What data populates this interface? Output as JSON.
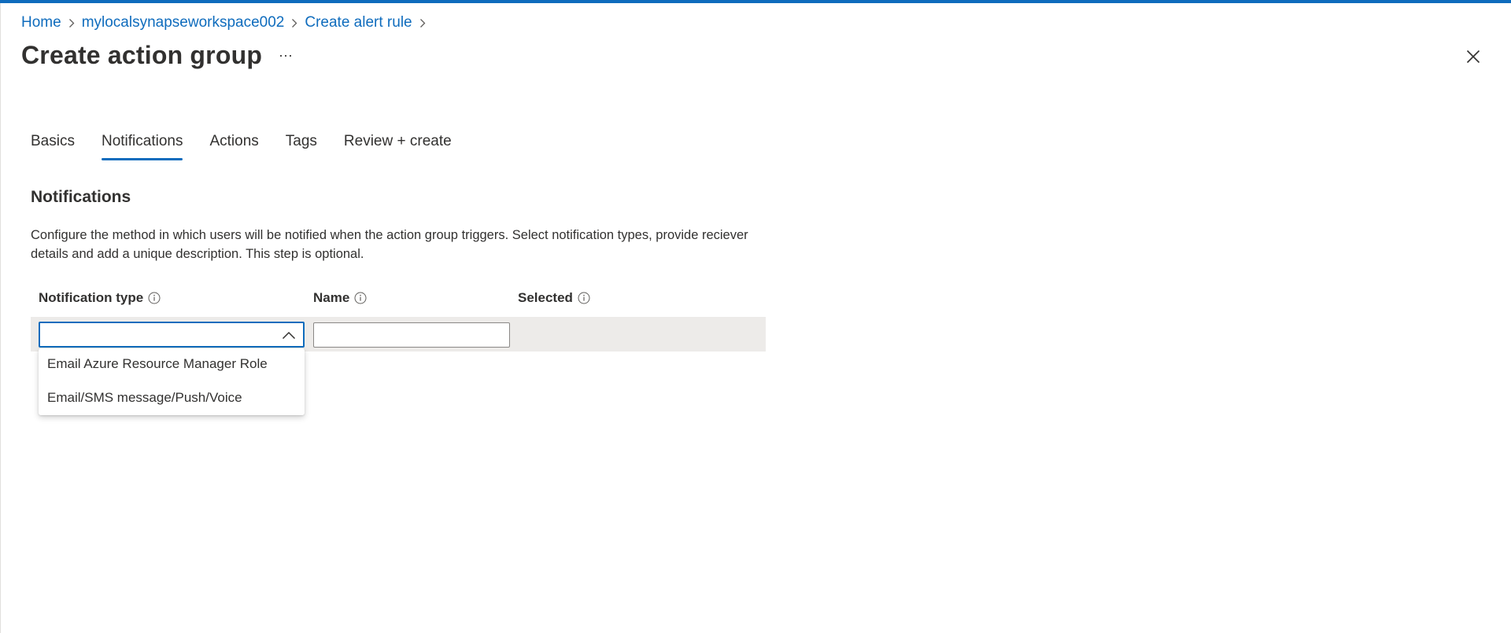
{
  "breadcrumb": {
    "items": [
      {
        "label": "Home"
      },
      {
        "label": "mylocalsynapseworkspace002"
      },
      {
        "label": "Create alert rule"
      }
    ]
  },
  "header": {
    "title": "Create action group",
    "more_label": "···"
  },
  "tabs": [
    {
      "label": "Basics",
      "active": false
    },
    {
      "label": "Notifications",
      "active": true
    },
    {
      "label": "Actions",
      "active": false
    },
    {
      "label": "Tags",
      "active": false
    },
    {
      "label": "Review + create",
      "active": false
    }
  ],
  "notifications": {
    "section_title": "Notifications",
    "description": "Configure the method in which users will be notified when the action group triggers. Select notification types, provide reciever details and add a unique description. This step is optional.",
    "columns": {
      "type": "Notification type",
      "name": "Name",
      "selected": "Selected"
    },
    "row": {
      "type_value": "",
      "name_value": ""
    },
    "dropdown_options": [
      "Email Azure Resource Manager Role",
      "Email/SMS message/Push/Voice"
    ]
  },
  "icons": {
    "close": "close-icon",
    "info": "info-icon",
    "chevron_up": "chevron-up-icon",
    "breadcrumb_separator": "chevron-right-icon"
  },
  "colors": {
    "accent": "#0f6cbd",
    "text": "#323130",
    "row_background": "#edebe9",
    "input_border": "#8a8886"
  }
}
